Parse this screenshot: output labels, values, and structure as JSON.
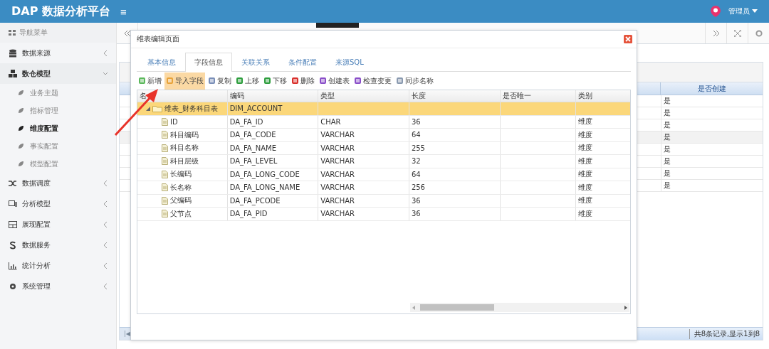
{
  "header": {
    "title": "DAP 数据分析平台",
    "menu_glyph": "≡",
    "user": "管理员"
  },
  "sidebar": {
    "heading": "导航菜单",
    "items": [
      {
        "label": "数据来源",
        "expanded": false
      },
      {
        "label": "数仓模型",
        "expanded": true,
        "children": [
          {
            "label": "业务主题",
            "selected": false
          },
          {
            "label": "指标管理",
            "selected": false
          },
          {
            "label": "维度配置",
            "selected": true
          },
          {
            "label": "事实配置",
            "selected": false
          },
          {
            "label": "模型配置",
            "selected": false
          }
        ]
      },
      {
        "label": "数据调度",
        "expanded": false
      },
      {
        "label": "分析模型",
        "expanded": false
      },
      {
        "label": "展现配置",
        "expanded": false
      },
      {
        "label": "数据服务",
        "expanded": false
      },
      {
        "label": "统计分析",
        "expanded": false
      },
      {
        "label": "系统管理",
        "expanded": false
      }
    ]
  },
  "background_grid": {
    "column": "是否创建",
    "rows": [
      "是",
      "是",
      "是",
      "是",
      "是",
      "是",
      "是",
      "是"
    ],
    "pager_first": "|◀",
    "pager_info": "共8条记录,显示1到8"
  },
  "dialog": {
    "title": "维表编辑页面",
    "tabs": [
      {
        "label": "基本信息",
        "selected": false
      },
      {
        "label": "字段信息",
        "selected": true
      },
      {
        "label": "关联关系",
        "selected": false
      },
      {
        "label": "条件配置",
        "selected": false
      },
      {
        "label": "来源SQL",
        "selected": false
      }
    ],
    "toolbar": [
      {
        "label": "新增",
        "hovered": false
      },
      {
        "label": "导入字段",
        "hovered": true
      },
      {
        "label": "复制",
        "hovered": false
      },
      {
        "label": "上移",
        "hovered": false
      },
      {
        "label": "下移",
        "hovered": false
      },
      {
        "label": "删除",
        "hovered": false
      },
      {
        "label": "创建表",
        "hovered": false
      },
      {
        "label": "检查变更",
        "hovered": false
      },
      {
        "label": "同步名称",
        "hovered": false
      }
    ],
    "columns": [
      "名",
      "编码",
      "类型",
      "长度",
      "是否唯一",
      "类别"
    ],
    "rows": [
      {
        "name": "维表_财务科目表",
        "code": "DIM_ACCOUNT",
        "selected": true,
        "expanded": true,
        "children": [
          {
            "name": "ID",
            "code": "DA_FA_ID",
            "type": "CHAR",
            "length": "36",
            "category": "维度"
          },
          {
            "name": "科目编码",
            "code": "DA_FA_CODE",
            "type": "VARCHAR",
            "length": "64",
            "category": "维度"
          },
          {
            "name": "科目名称",
            "code": "DA_FA_NAME",
            "type": "VARCHAR",
            "length": "255",
            "category": "维度"
          },
          {
            "name": "科目层级",
            "code": "DA_FA_LEVEL",
            "type": "VARCHAR",
            "length": "32",
            "category": "维度"
          },
          {
            "name": "长编码",
            "code": "DA_FA_LONG_CODE",
            "type": "VARCHAR",
            "length": "64",
            "category": "维度"
          },
          {
            "name": "长名称",
            "code": "DA_FA_LONG_NAME",
            "type": "VARCHAR",
            "length": "256",
            "category": "维度"
          },
          {
            "name": "父编码",
            "code": "DA_FA_PCODE",
            "type": "VARCHAR",
            "length": "36",
            "category": "维度"
          },
          {
            "name": "父节点",
            "code": "DA_FA_PID",
            "type": "VARCHAR",
            "length": "36",
            "category": "维度"
          }
        ]
      }
    ]
  }
}
